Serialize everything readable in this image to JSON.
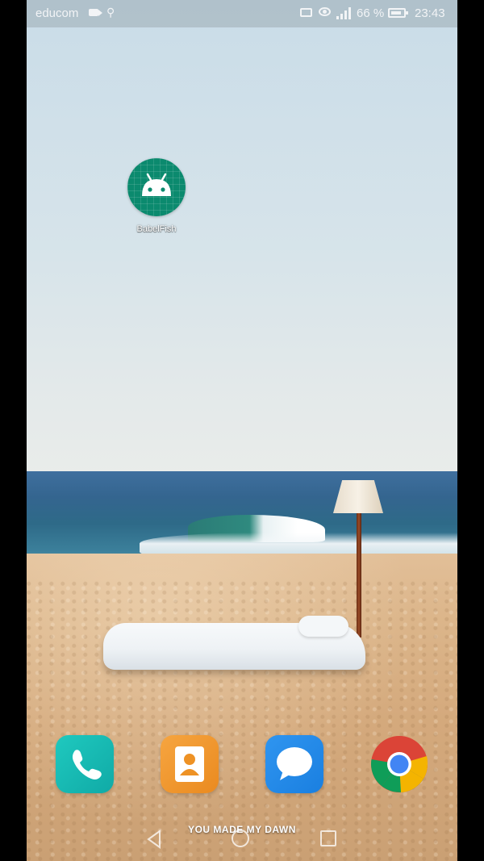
{
  "status_bar": {
    "carrier": "educom",
    "battery_percent": "66 %",
    "time": "23:43",
    "icons": [
      "video-camera-icon",
      "usb-icon",
      "cast-icon",
      "eye-comfort-icon",
      "signal-icon",
      "battery-icon"
    ]
  },
  "home_screen": {
    "apps": [
      {
        "label": "BabelFish",
        "icon": "android-robot-icon",
        "color": "#0b8a6e"
      }
    ]
  },
  "dock": {
    "apps": [
      {
        "name": "phone",
        "icon": "phone-icon",
        "color": "#13b3ad"
      },
      {
        "name": "contacts",
        "icon": "contacts-icon",
        "color": "#f09a2e"
      },
      {
        "name": "messages",
        "icon": "message-bubble-icon",
        "color": "#2589e8"
      },
      {
        "name": "chrome",
        "icon": "chrome-icon",
        "color": "#db4437"
      }
    ]
  },
  "wallpaper_banner": "YOU MADE MY DAWN",
  "nav_bar": {
    "buttons": [
      "back-icon",
      "home-icon",
      "recents-icon"
    ]
  }
}
